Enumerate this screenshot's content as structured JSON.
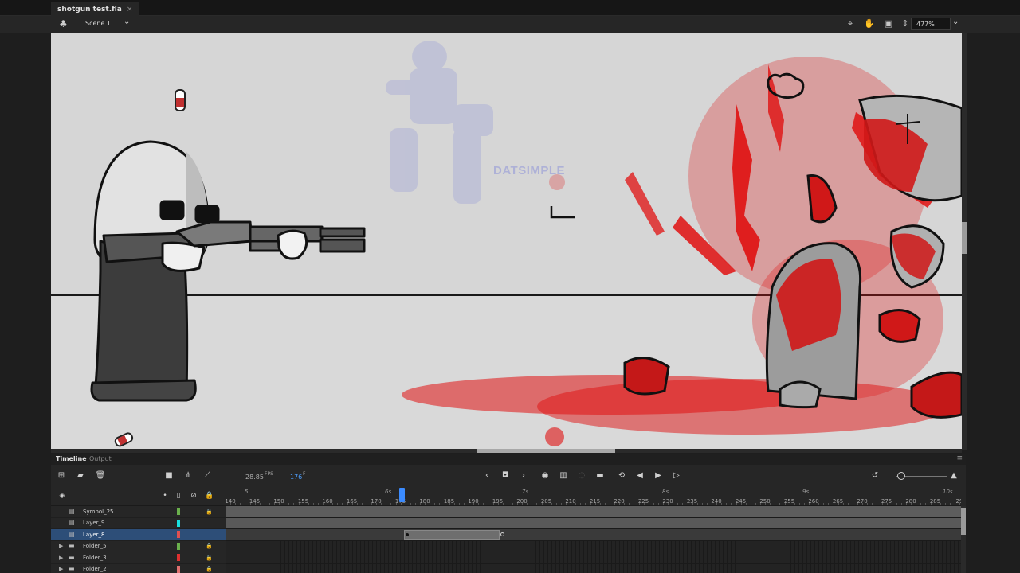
{
  "document": {
    "tab_title": "shotgun test.fla",
    "close_glyph": "×"
  },
  "edit_bar": {
    "scene_label": "Scene 1",
    "zoom": "477%",
    "icons": [
      "scene-icon",
      "center-stage-icon",
      "hand-tool-icon",
      "clip-content-icon",
      "zoom-stepper-icon"
    ]
  },
  "stage": {
    "watermark": "DATSIMPLE",
    "background_color": "#d6d6d6",
    "blood_color": "#e01010"
  },
  "timeline": {
    "tabs": [
      "Timeline",
      "Output"
    ],
    "fps_value": "28.85",
    "fps_unit": "FPS",
    "current_frame": "176",
    "frame_unit": "F",
    "seconds_labels": [
      "5",
      "6s",
      "7s",
      "8s",
      "9s",
      "10s"
    ],
    "frame_numbers": [
      "140",
      "145",
      "150",
      "155",
      "160",
      "165",
      "170",
      "175",
      "180",
      "185",
      "190",
      "195",
      "200",
      "205",
      "210",
      "215",
      "220",
      "225",
      "230",
      "235",
      "240",
      "245",
      "250",
      "255",
      "260",
      "265",
      "270",
      "275",
      "280",
      "285",
      "29"
    ],
    "layers": [
      {
        "name": "Symbol_25",
        "type": "layer",
        "color": "#6ab04c",
        "locked": true
      },
      {
        "name": "Layer_9",
        "type": "layer",
        "color": "#18e0e0",
        "locked": false
      },
      {
        "name": "Layer_8",
        "type": "layer",
        "color": "#e05050",
        "locked": false,
        "selected": true
      },
      {
        "name": "Folder_5",
        "type": "folder",
        "color": "#6ab04c",
        "locked": true
      },
      {
        "name": "Folder_3",
        "type": "folder",
        "color": "#e03030",
        "locked": true
      },
      {
        "name": "Folder_2",
        "type": "folder",
        "color": "#e07070",
        "locked": true
      }
    ]
  }
}
